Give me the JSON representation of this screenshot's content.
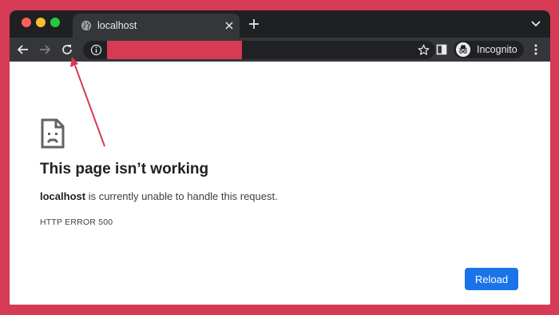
{
  "tab": {
    "title": "localhost",
    "icon": "globe-icon"
  },
  "toolbar": {
    "url": "",
    "incognito_label": "Incognito"
  },
  "page": {
    "heading": "This page isn’t working",
    "host": "localhost",
    "message": " is currently unable to handle this request.",
    "error_code": "HTTP ERROR 500",
    "reload_label": "Reload"
  },
  "colors": {
    "background": "#d63a55",
    "redaction": "#d63a55",
    "tabstrip": "#1f2022",
    "toolbar": "#35363a",
    "reload_button": "#1a73e8",
    "annotation_arrow": "#d63a55"
  }
}
